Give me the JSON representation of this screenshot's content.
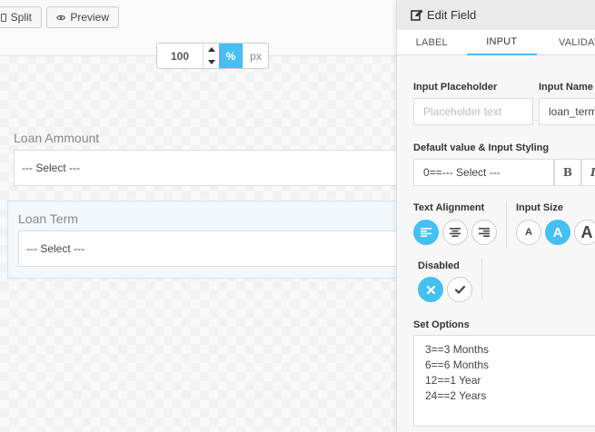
{
  "toolbar": {
    "split_label": "Split",
    "preview_label": "Preview"
  },
  "width_control": {
    "value": "100",
    "unit_percent": "%",
    "unit_px": "px"
  },
  "form": {
    "loan_amount": {
      "label": "Loan Ammount",
      "select_value": "--- Select ---"
    },
    "loan_term": {
      "label": "Loan Term",
      "select_value": "--- Select ---"
    }
  },
  "panel": {
    "title": "Edit Field",
    "tabs": [
      {
        "label": "LABEL",
        "active": false
      },
      {
        "label": "INPUT",
        "active": true
      },
      {
        "label": "VALIDAT",
        "active": false
      }
    ],
    "input_placeholder_label": "Input Placeholder",
    "input_placeholder_hint": "Placeholder text",
    "input_name_label": "Input Name",
    "input_name_value": "loan_term",
    "default_value_label": "Default value & Input Styling",
    "default_value": "0==--- Select ---",
    "bold_label": "B",
    "italic_label": "I",
    "text_alignment_label": "Text Alignment",
    "text_alignment_selected": "left",
    "input_size_label": "Input Size",
    "input_size_glyph": "A",
    "input_size_selected": "medium",
    "disabled_label": "Disabled",
    "disabled_selected": "no",
    "set_options_label": "Set Options",
    "options": [
      "3==3 Months",
      "6==6 Months",
      "12==1 Year",
      "24==2 Years"
    ]
  },
  "colors": {
    "accent": "#45c0f0"
  }
}
